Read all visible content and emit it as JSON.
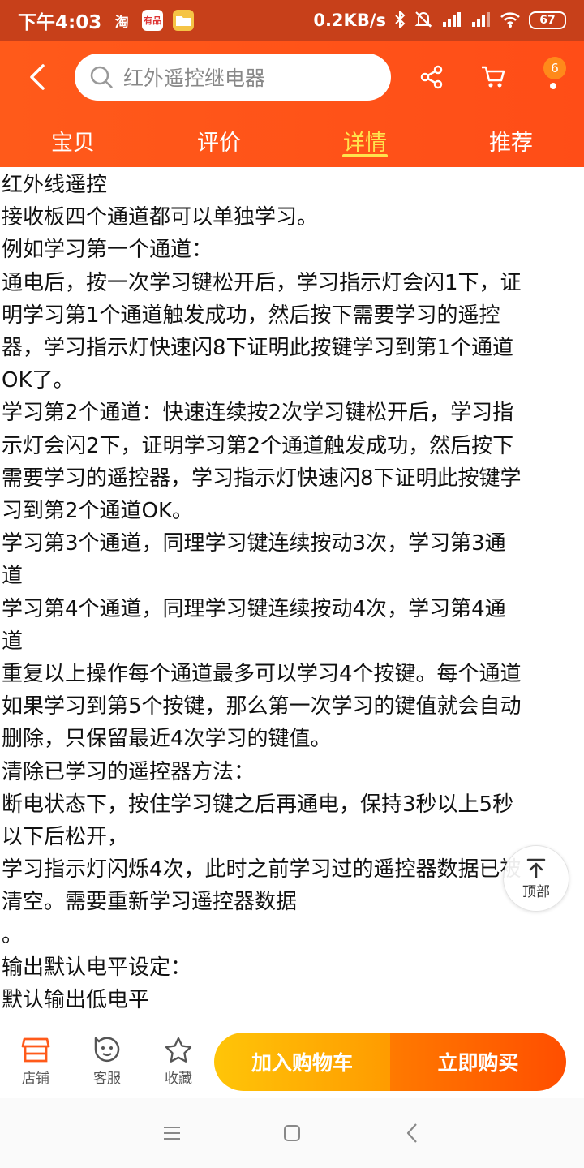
{
  "status_bar": {
    "time": "下午4:03",
    "app_taobao": "淘",
    "app_youpin": "有品",
    "speed": "0.2KB/s",
    "battery": "67"
  },
  "header": {
    "search_text": "红外遥控继电器",
    "cart_badge": "6"
  },
  "tabs": [
    {
      "label": "宝贝"
    },
    {
      "label": "评价"
    },
    {
      "label": "详情"
    },
    {
      "label": "推荐"
    }
  ],
  "content": {
    "lines": [
      "红外线遥控",
      "接收板四个通道都可以单独学习。",
      "例如学习第一个通道：",
      "通电后，按一次学习键松开后，学习指示灯会闪1下，证",
      "明学习第1个通道触发成功，然后按下需要学习的遥控",
      "器，学习指示灯快速闪8下证明此按键学习到第1个通道",
      "OK了。",
      "学习第2个通道：快速连续按2次学习键松开后，学习指",
      "示灯会闪2下，证明学习第2个通道触发成功，然后按下",
      "需要学习的遥控器，学习指示灯快速闪8下证明此按键学",
      "习到第2个通道OK。",
      "学习第3个通道，同理学习键连续按动3次，学习第3通",
      "道",
      "学习第4个通道，同理学习键连续按动4次，学习第4通",
      "道",
      "重复以上操作每个通道最多可以学习4个按键。每个通道",
      "如果学习到第5个按键，那么第一次学习的键值就会自动",
      "删除，只保留最近4次学习的键值。",
      "清除已学习的遥控器方法：",
      "断电状态下，按住学习键之后再通电，保持3秒以上5秒",
      "以下后松开，",
      "学习指示灯闪烁4次，此时之前学习过的遥控器数据已被",
      "清空。需要重新学习遥控器数据",
      "。",
      "输出默认电平设定：",
      "默认输出低电平"
    ]
  },
  "back_to_top": {
    "label": "顶部"
  },
  "bottom_bar": {
    "store_label": "店铺",
    "service_label": "客服",
    "favorite_label": "收藏",
    "add_cart_label": "加入购物车",
    "buy_now_label": "立即购买"
  },
  "colors": {
    "brand_orange": "#ff5a1a",
    "status_bar": "#c7401a",
    "active_tab": "#ffe34d",
    "add_cart": "#ffb300",
    "buy_now": "#ff5500"
  }
}
